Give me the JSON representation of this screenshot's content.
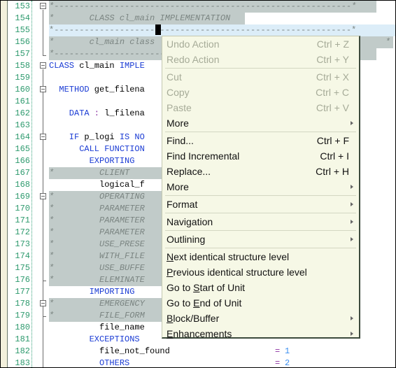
{
  "editor": {
    "line_numbers": [
      "153",
      "154",
      "155",
      "156",
      "157",
      "158",
      "159",
      "160",
      "161",
      "162",
      "163",
      "164",
      "165",
      "166",
      "167",
      "168",
      "169",
      "170",
      "171",
      "172",
      "173",
      "174",
      "175",
      "176",
      "177",
      "178",
      "179",
      "180",
      "181",
      "182",
      "183"
    ],
    "lines": {
      "l153": "*-----------------------------------------------------------*",
      "l154": "*       CLASS cl_main IMPLEMENTATION",
      "l155": "*-----------------------------------------------------------*",
      "l156": "*       cl_main class",
      "l156_tail": "*",
      "l157": "*-----------------------------------------------------------*",
      "l158_kw1": "CLASS",
      "l158_id": " cl_main ",
      "l158_kw2": "IMPLE",
      "l160_kw": "  METHOD",
      "l160_id": " get_filena",
      "l162_kw": "    DATA",
      "l162_op": " : ",
      "l162_id": "l_filena",
      "l164_kw1": "    IF",
      "l164_id": " p_logi ",
      "l164_kw2": "IS NO",
      "l165_kw": "      CALL FUNCTION",
      "l166_kw": "        EXPORTING",
      "l167": "*         CLIENT",
      "l168_id": "          logical_f",
      "l169": "*         OPERATING",
      "l170": "*         PARAMETER",
      "l171": "*         PARAMETER",
      "l172": "*         PARAMETER",
      "l173": "*         USE_PRESE",
      "l174": "*         WITH_FILE",
      "l175": "*         USE_BUFFE",
      "l176": "*         ELEMINATE",
      "l177_kw": "        IMPORTING",
      "l178": "*         EMERGENCY",
      "l179": "*         FILE_FORM",
      "l180_id": "          file_name",
      "l181_kw": "        EXCEPTIONS",
      "l182_id": "          file_not_found",
      "l182_op": "=",
      "l182_num": "1",
      "l183_kw": "          OTHERS",
      "l183_op": "=",
      "l183_num": "2"
    }
  },
  "context_menu": {
    "items": [
      {
        "label": "Undo Action",
        "shortcut": "Ctrl + Z",
        "enabled": false
      },
      {
        "label": "Redo Action",
        "shortcut": "Ctrl + Y",
        "enabled": false
      },
      {
        "label": "Cut",
        "shortcut": "Ctrl + X",
        "enabled": false
      },
      {
        "label": "Copy",
        "shortcut": "Ctrl + C",
        "enabled": false
      },
      {
        "label": "Paste",
        "shortcut": "Ctrl + V",
        "enabled": false
      },
      {
        "label": "More",
        "submenu": true
      },
      {
        "label": "Find...",
        "shortcut": "Ctrl + F",
        "enabled": true
      },
      {
        "label": "Find Incremental",
        "shortcut": "Ctrl + I",
        "enabled": true
      },
      {
        "label": "Replace...",
        "shortcut": "Ctrl + H",
        "enabled": true
      },
      {
        "label": "More",
        "submenu": true
      },
      {
        "label": "Format",
        "submenu": true
      },
      {
        "label": "Navigation",
        "submenu": true
      },
      {
        "label": "Outlining",
        "submenu": true
      },
      {
        "label_ul": "N",
        "label_rest": "ext identical structure level"
      },
      {
        "label_ul": "P",
        "label_rest": "revious identical structure level"
      },
      {
        "label_pre": "Go to ",
        "label_ul": "S",
        "label_rest": "tart of Unit"
      },
      {
        "label_pre": "Go to ",
        "label_ul": "E",
        "label_rest": "nd of Unit"
      },
      {
        "label_ul": "B",
        "label_rest": "lock/Buffer",
        "submenu": true
      },
      {
        "label_ul": "E",
        "label_rest": "nhancements",
        "submenu": true
      }
    ]
  }
}
